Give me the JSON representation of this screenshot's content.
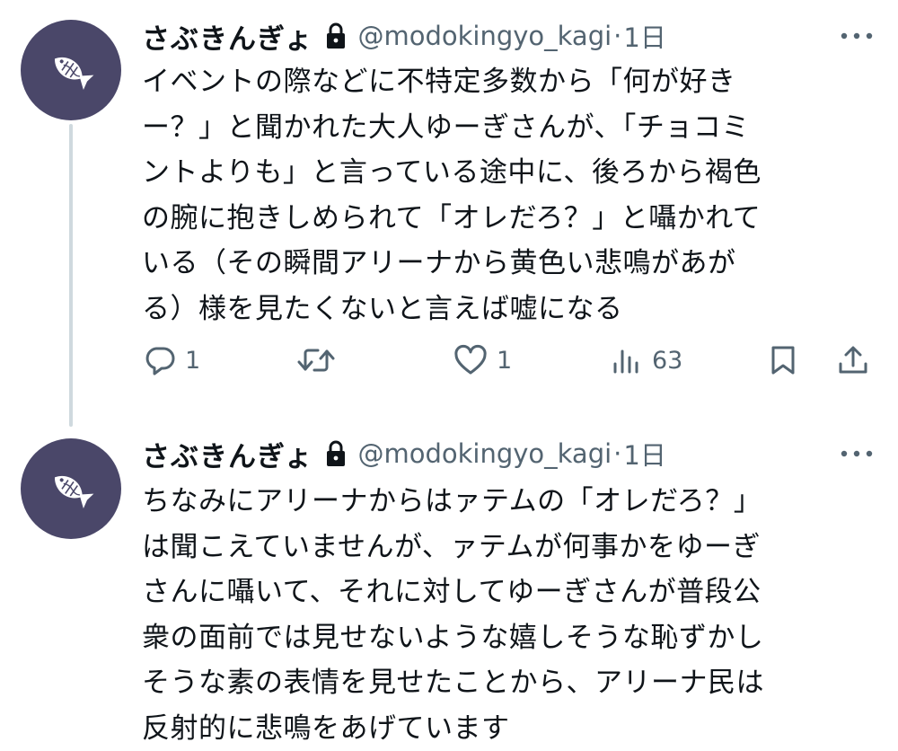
{
  "tweets": [
    {
      "display_name": "さぶきんぎょ",
      "handle": "@modokingyo_kagi",
      "separator": "·",
      "time": "1日",
      "lines": [
        "イベントの際などに不特定多数から「何が好き",
        "ー？」と聞かれた大人ゆーぎさんが、「チョコミ",
        "ントよりも」と言っている途中に、後ろから褐色",
        "の腕に抱きしめられて「オレだろ？」と囁かれて",
        "いる（その瞬間アリーナから黄色い悲鳴があが",
        "る）様を見たくないと言えば嘘になる"
      ],
      "actions": {
        "reply_icon": "reply-icon",
        "reply_count": "1",
        "retweet_icon": "retweet-icon",
        "like_icon": "heart-icon",
        "like_count": "1",
        "views_icon": "views-icon",
        "views_count": "63",
        "bookmark_icon": "bookmark-icon",
        "share_icon": "share-icon"
      }
    },
    {
      "display_name": "さぶきんぎょ",
      "handle": "@modokingyo_kagi",
      "separator": "·",
      "time": "1日",
      "lines": [
        "ちなみにアリーナからはァテムの「オレだろ？」",
        "は聞こえていませんが、ァテムが何事かをゆーぎ",
        "さんに囁いて、それに対してゆーぎさんが普段公",
        "衆の面前では見せないような嬉しそうな恥ずかし",
        "そうな素の表情を見せたことから、アリーナ民は",
        "反射的に悲鳴をあげています"
      ]
    }
  ],
  "colors": {
    "avatar_bg": "#4a4769",
    "text": "#0f1419",
    "secondary": "#536471",
    "thread_line": "#cfd9de"
  }
}
